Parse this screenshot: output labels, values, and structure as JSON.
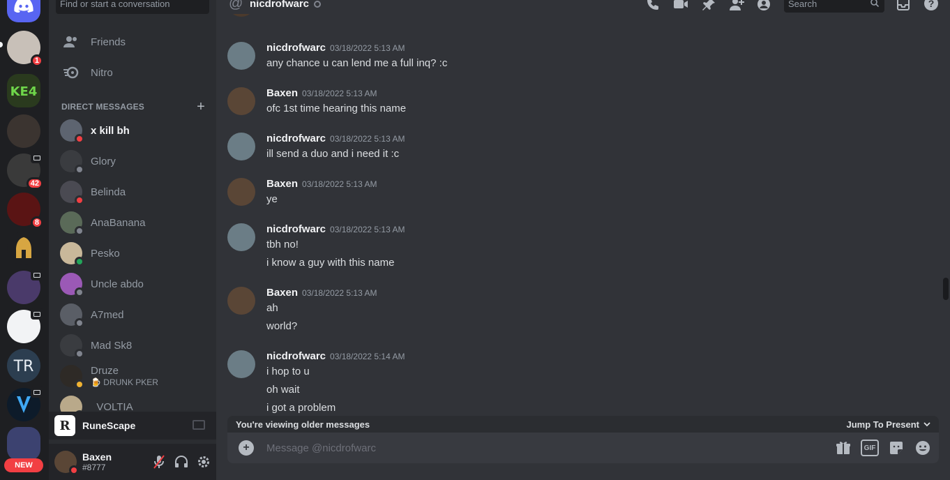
{
  "sidebar": {
    "search_placeholder": "Find or start a conversation",
    "nav": [
      {
        "label": "Friends"
      },
      {
        "label": "Nitro"
      }
    ],
    "dm_header": "DIRECT MESSAGES",
    "dms": [
      {
        "name": "x kill bh",
        "status": "dnd",
        "status_color": "#f23f43",
        "avatar_color": "#5d6470",
        "active": true
      },
      {
        "name": "Glory",
        "status": "offline",
        "status_color": "#80848e",
        "avatar_color": "#3a3c40"
      },
      {
        "name": "Belinda",
        "status": "dnd",
        "status_color": "#f23f43",
        "avatar_color": "#4a4a52"
      },
      {
        "name": "AnaBanana",
        "status": "offline",
        "status_color": "#80848e",
        "avatar_color": "#5a6a58"
      },
      {
        "name": "Pesko",
        "status": "online",
        "status_color": "#23a55a",
        "avatar_color": "#c9b89a"
      },
      {
        "name": "Uncle abdo",
        "status": "offline",
        "status_color": "#80848e",
        "avatar_color": "#9b59b6"
      },
      {
        "name": "A7med",
        "status": "offline",
        "status_color": "#80848e",
        "avatar_color": "#5a5e66"
      },
      {
        "name": "Mad Sk8",
        "status": "offline",
        "status_color": "#80848e",
        "avatar_color": "#3a3c40"
      },
      {
        "name": "Druze",
        "sub": "🍺 DRUNK PKER",
        "status": "idle",
        "status_color": "#f0b232",
        "avatar_color": "#2e2a26"
      },
      {
        "name": "_VOLTIA",
        "status": "offline",
        "status_color": "#80848e",
        "avatar_color": "#b9a98a"
      }
    ]
  },
  "voice": {
    "logo_letter": "R",
    "label": "RuneScape"
  },
  "user": {
    "name": "Baxen",
    "tag": "#8777"
  },
  "servers": {
    "badges": [
      "1",
      "42",
      "8"
    ],
    "new_label": "NEW"
  },
  "header": {
    "title": "nicdrofwarc",
    "search_placeholder": "Search"
  },
  "messages": [
    {
      "author": "nicdrofwarc",
      "timestamp": "03/18/2022 5:13 AM",
      "lines": [
        "any chance u can lend me a full inq? :c"
      ]
    },
    {
      "author": "Baxen",
      "timestamp": "03/18/2022 5:13 AM",
      "lines": [
        "ofc 1st time hearing this name"
      ]
    },
    {
      "author": "nicdrofwarc",
      "timestamp": "03/18/2022 5:13 AM",
      "lines": [
        "ill send a duo and i need it :c"
      ]
    },
    {
      "author": "Baxen",
      "timestamp": "03/18/2022 5:13 AM",
      "lines": [
        "ye"
      ]
    },
    {
      "author": "nicdrofwarc",
      "timestamp": "03/18/2022 5:13 AM",
      "lines": [
        "tbh no!",
        "i know a guy with this name"
      ]
    },
    {
      "author": "Baxen",
      "timestamp": "03/18/2022 5:13 AM",
      "lines": [
        "ah",
        "world?"
      ]
    },
    {
      "author": "nicdrofwarc",
      "timestamp": "03/18/2022 5:14 AM",
      "lines": [
        "i hop to u",
        "oh wait",
        "i got a problem"
      ]
    }
  ],
  "older_bar": {
    "notice": "You're viewing older messages",
    "jump_label": "Jump To Present"
  },
  "composer": {
    "placeholder": "Message @nicdrofwarc"
  },
  "colors": {
    "blurple": "#5865f2",
    "dnd": "#f23f43",
    "online": "#23a55a",
    "idle": "#f0b232"
  }
}
